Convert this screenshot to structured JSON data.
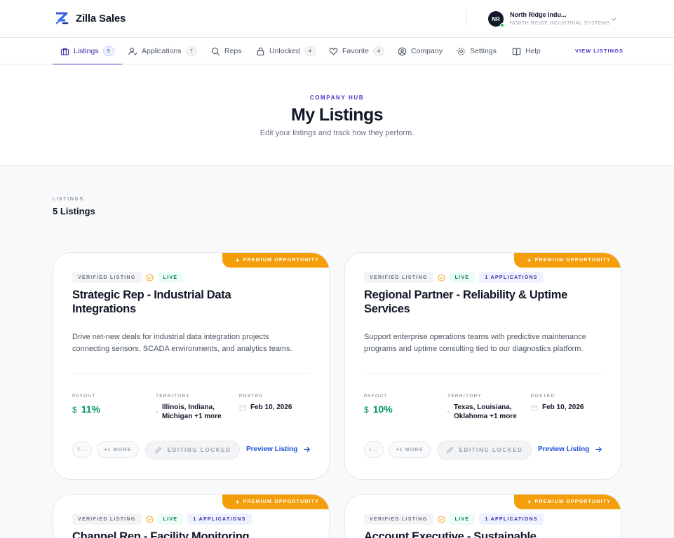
{
  "brand": {
    "name": "Zilla Sales"
  },
  "account": {
    "initials": "NR",
    "name": "North Ridge Indu...",
    "subtitle": "NORTH RIDGE INDUSTRIAL SYSTEMS"
  },
  "nav": {
    "items": [
      {
        "label": "Listings",
        "badge": "5",
        "icon": "briefcase-icon"
      },
      {
        "label": "Applications",
        "badge": "7",
        "icon": "user-check-icon"
      },
      {
        "label": "Reps",
        "icon": "search-icon"
      },
      {
        "label": "Unlocked",
        "badge": "4",
        "icon": "lock-icon"
      },
      {
        "label": "Favorite",
        "badge": "4",
        "icon": "heart-icon"
      },
      {
        "label": "Company",
        "icon": "user-circle-icon"
      },
      {
        "label": "Settings",
        "icon": "gear-icon"
      },
      {
        "label": "Help",
        "icon": "book-icon"
      }
    ],
    "cta": "VIEW LISTINGS"
  },
  "hero": {
    "eyebrow": "COMPANY HUB",
    "title": "My Listings",
    "subtitle": "Edit your listings and track how they perform."
  },
  "section": {
    "eyebrow": "LISTINGS",
    "title": "5 Listings"
  },
  "labels": {
    "ribbon": "PREMIUM OPPORTUNITY",
    "verified": "VERIFIED LISTING",
    "live": "LIVE",
    "payout": "PAYOUT",
    "territory": "TERRITORY",
    "posted": "POSTED",
    "payout_currency": "$",
    "more": "+1 MORE",
    "editing_locked": "EDITING LOCKED",
    "preview": "Preview Listing"
  },
  "colors": {
    "accent": "#4338ca",
    "premium": "#f59e0b",
    "payout": "#059669",
    "link": "#1d4ed8"
  },
  "listings": [
    {
      "title": "Strategic Rep - Industrial Data Integrations",
      "description": "Drive net-new deals for industrial data integration projects connecting sensors, SCADA environments, and analytics teams.",
      "payout": "11%",
      "territory": "Illinois, Indiana, Michigan +1 more",
      "posted": "Feb 10, 2026",
      "chip": "T..."
    },
    {
      "title": "Regional Partner - Reliability & Uptime Services",
      "description": "Support enterprise operations teams with predictive maintenance programs and uptime consulting tied to our diagnostics platform.",
      "applications": "1 APPLICATIONS",
      "payout": "10%",
      "territory": "Texas, Louisiana, Oklahoma +1 more",
      "posted": "Feb 10, 2026",
      "chip": "I..."
    },
    {
      "title": "Channel Rep - Facility Monitoring",
      "applications": "1 APPLICATIONS"
    },
    {
      "title": "Account Executive - Sustainable",
      "applications": "1 APPLICATIONS"
    }
  ]
}
